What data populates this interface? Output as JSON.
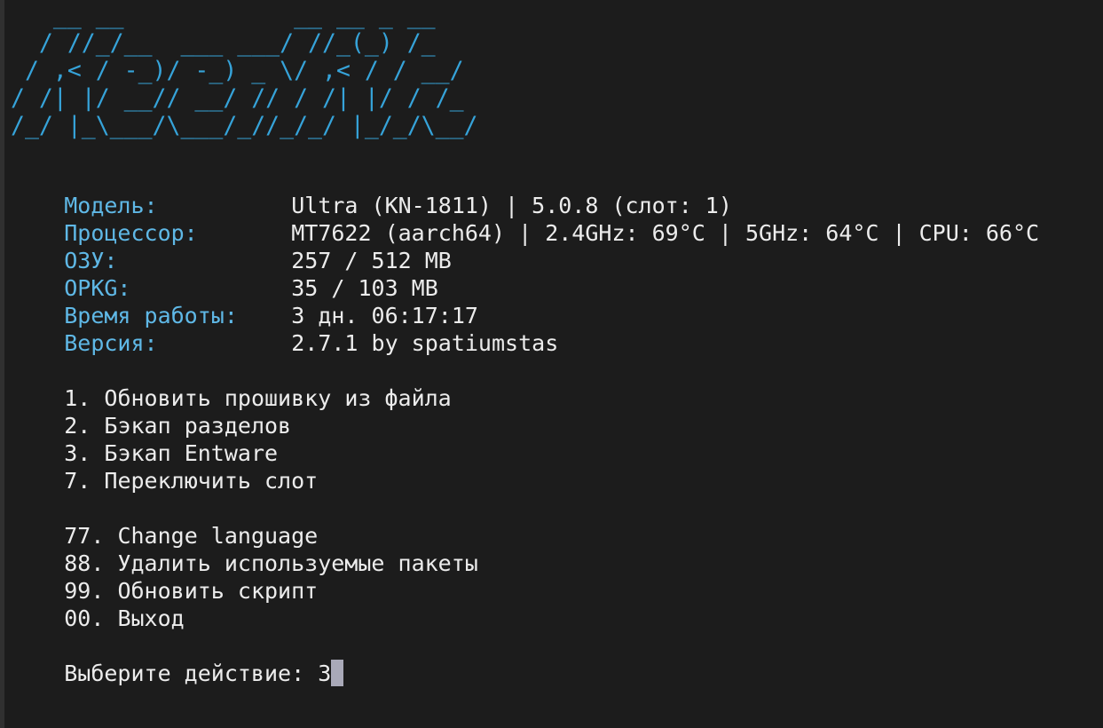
{
  "banner": {
    "ascii_art": "   __ __            __ __ _ __\n  / //_/__  ___ ___/ //_(_) /_\n / ,< / -_)/ -_) _ \\/ ,< / / __/\n/ /| |/ __// __/ // / /| |/ / /_\n/_/ |_\\___/\\___/_//_/_/ |_/_/\\__/",
    "color": "#36a3d9"
  },
  "info": [
    {
      "label": "Модель:",
      "value": "Ultra (KN-1811) | 5.0.8 (слот: 1)"
    },
    {
      "label": "Процессор:",
      "value": "MT7622 (aarch64) | 2.4GHz: 69°C | 5GHz: 64°C | CPU: 66°C"
    },
    {
      "label": "ОЗУ:",
      "value": "257 / 512 MB"
    },
    {
      "label": "OPKG:",
      "value": "35 / 103 MB"
    },
    {
      "label": "Время работы:",
      "value": "3 дн. 06:17:17"
    },
    {
      "label": "Версия:",
      "value": "2.7.1 by spatiumstas"
    }
  ],
  "menu": [
    {
      "key": "1.",
      "label": "Обновить прошивку из файла"
    },
    {
      "key": "2.",
      "label": "Бэкап разделов"
    },
    {
      "key": "3.",
      "label": "Бэкап Entware"
    },
    {
      "key": "7.",
      "label": "Переключить слот"
    }
  ],
  "menu_extra": [
    {
      "key": "77.",
      "label": "Change language"
    },
    {
      "key": "88.",
      "label": "Удалить используемые пакеты"
    },
    {
      "key": "99.",
      "label": "Обновить скрипт"
    },
    {
      "key": "00.",
      "label": "Выход"
    }
  ],
  "prompt": {
    "label": "Выберите действие:",
    "input": "3"
  },
  "colors": {
    "background": "#1c1c1c",
    "text": "#ececec",
    "label": "#5fb8e6",
    "cursor": "#a9a9b8"
  }
}
